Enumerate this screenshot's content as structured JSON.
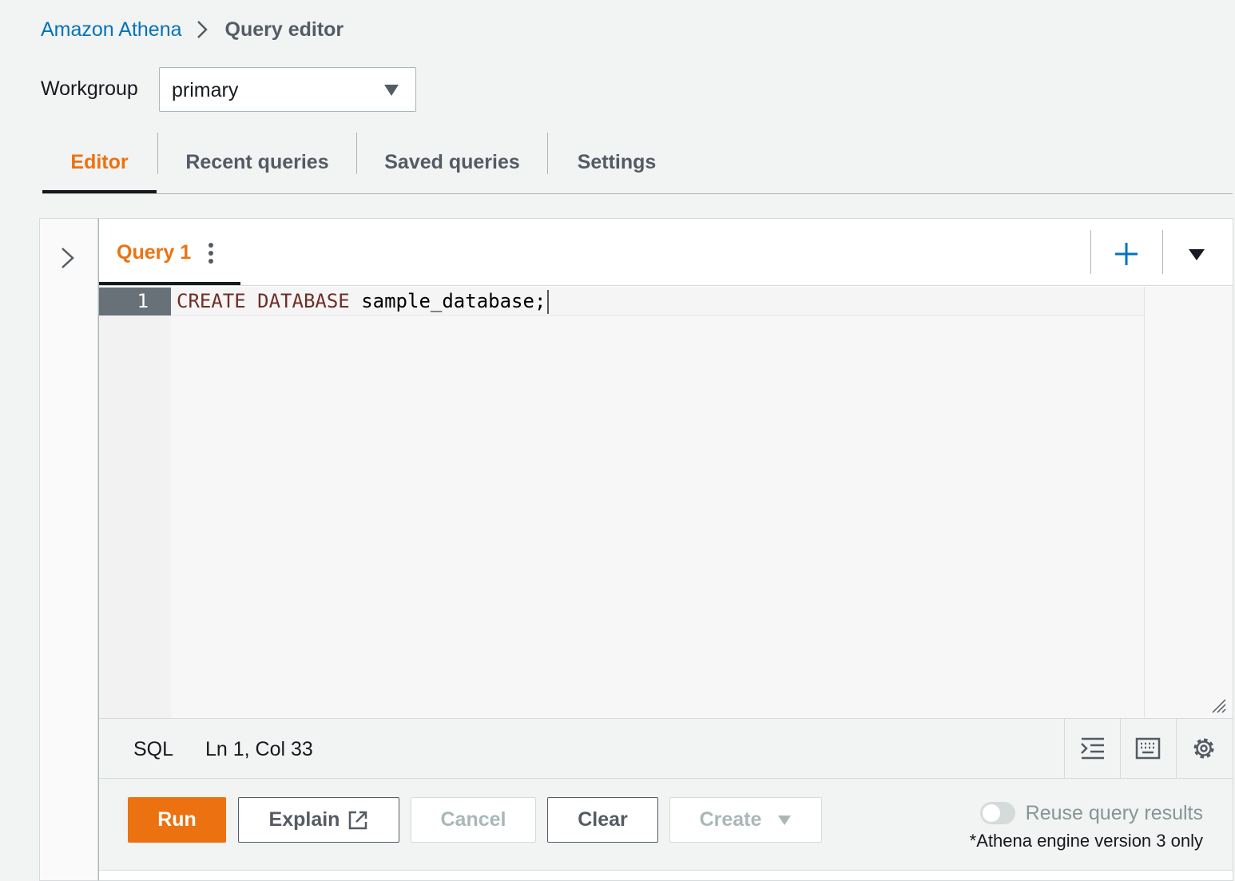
{
  "breadcrumb": {
    "parent": "Amazon Athena",
    "current": "Query editor"
  },
  "workgroup": {
    "label": "Workgroup",
    "value": "primary"
  },
  "tabs": [
    {
      "label": "Editor",
      "active": true
    },
    {
      "label": "Recent queries",
      "active": false
    },
    {
      "label": "Saved queries",
      "active": false
    },
    {
      "label": "Settings",
      "active": false
    }
  ],
  "query_tab": {
    "label": "Query 1"
  },
  "editor": {
    "line_number": "1",
    "keyword1": "CREATE",
    "keyword2": "DATABASE",
    "identifier": "sample_database;"
  },
  "status": {
    "language": "SQL",
    "position": "Ln 1, Col 33"
  },
  "actions": {
    "run": "Run",
    "explain": "Explain",
    "cancel": "Cancel",
    "clear": "Clear",
    "create": "Create"
  },
  "reuse": {
    "label": "Reuse query results",
    "note": "*Athena engine version 3 only",
    "enabled": false
  },
  "colors": {
    "accent": "#ec7211",
    "link": "#0073bb",
    "text": "#16191f",
    "muted": "#545b64",
    "disabled": "#aab7b8"
  },
  "icons": [
    "chevron-right-icon",
    "caret-down-icon",
    "kebab-menu-icon",
    "plus-icon",
    "indent-icon",
    "keyboard-icon",
    "gear-icon",
    "external-link-icon",
    "resize-grip-icon"
  ]
}
